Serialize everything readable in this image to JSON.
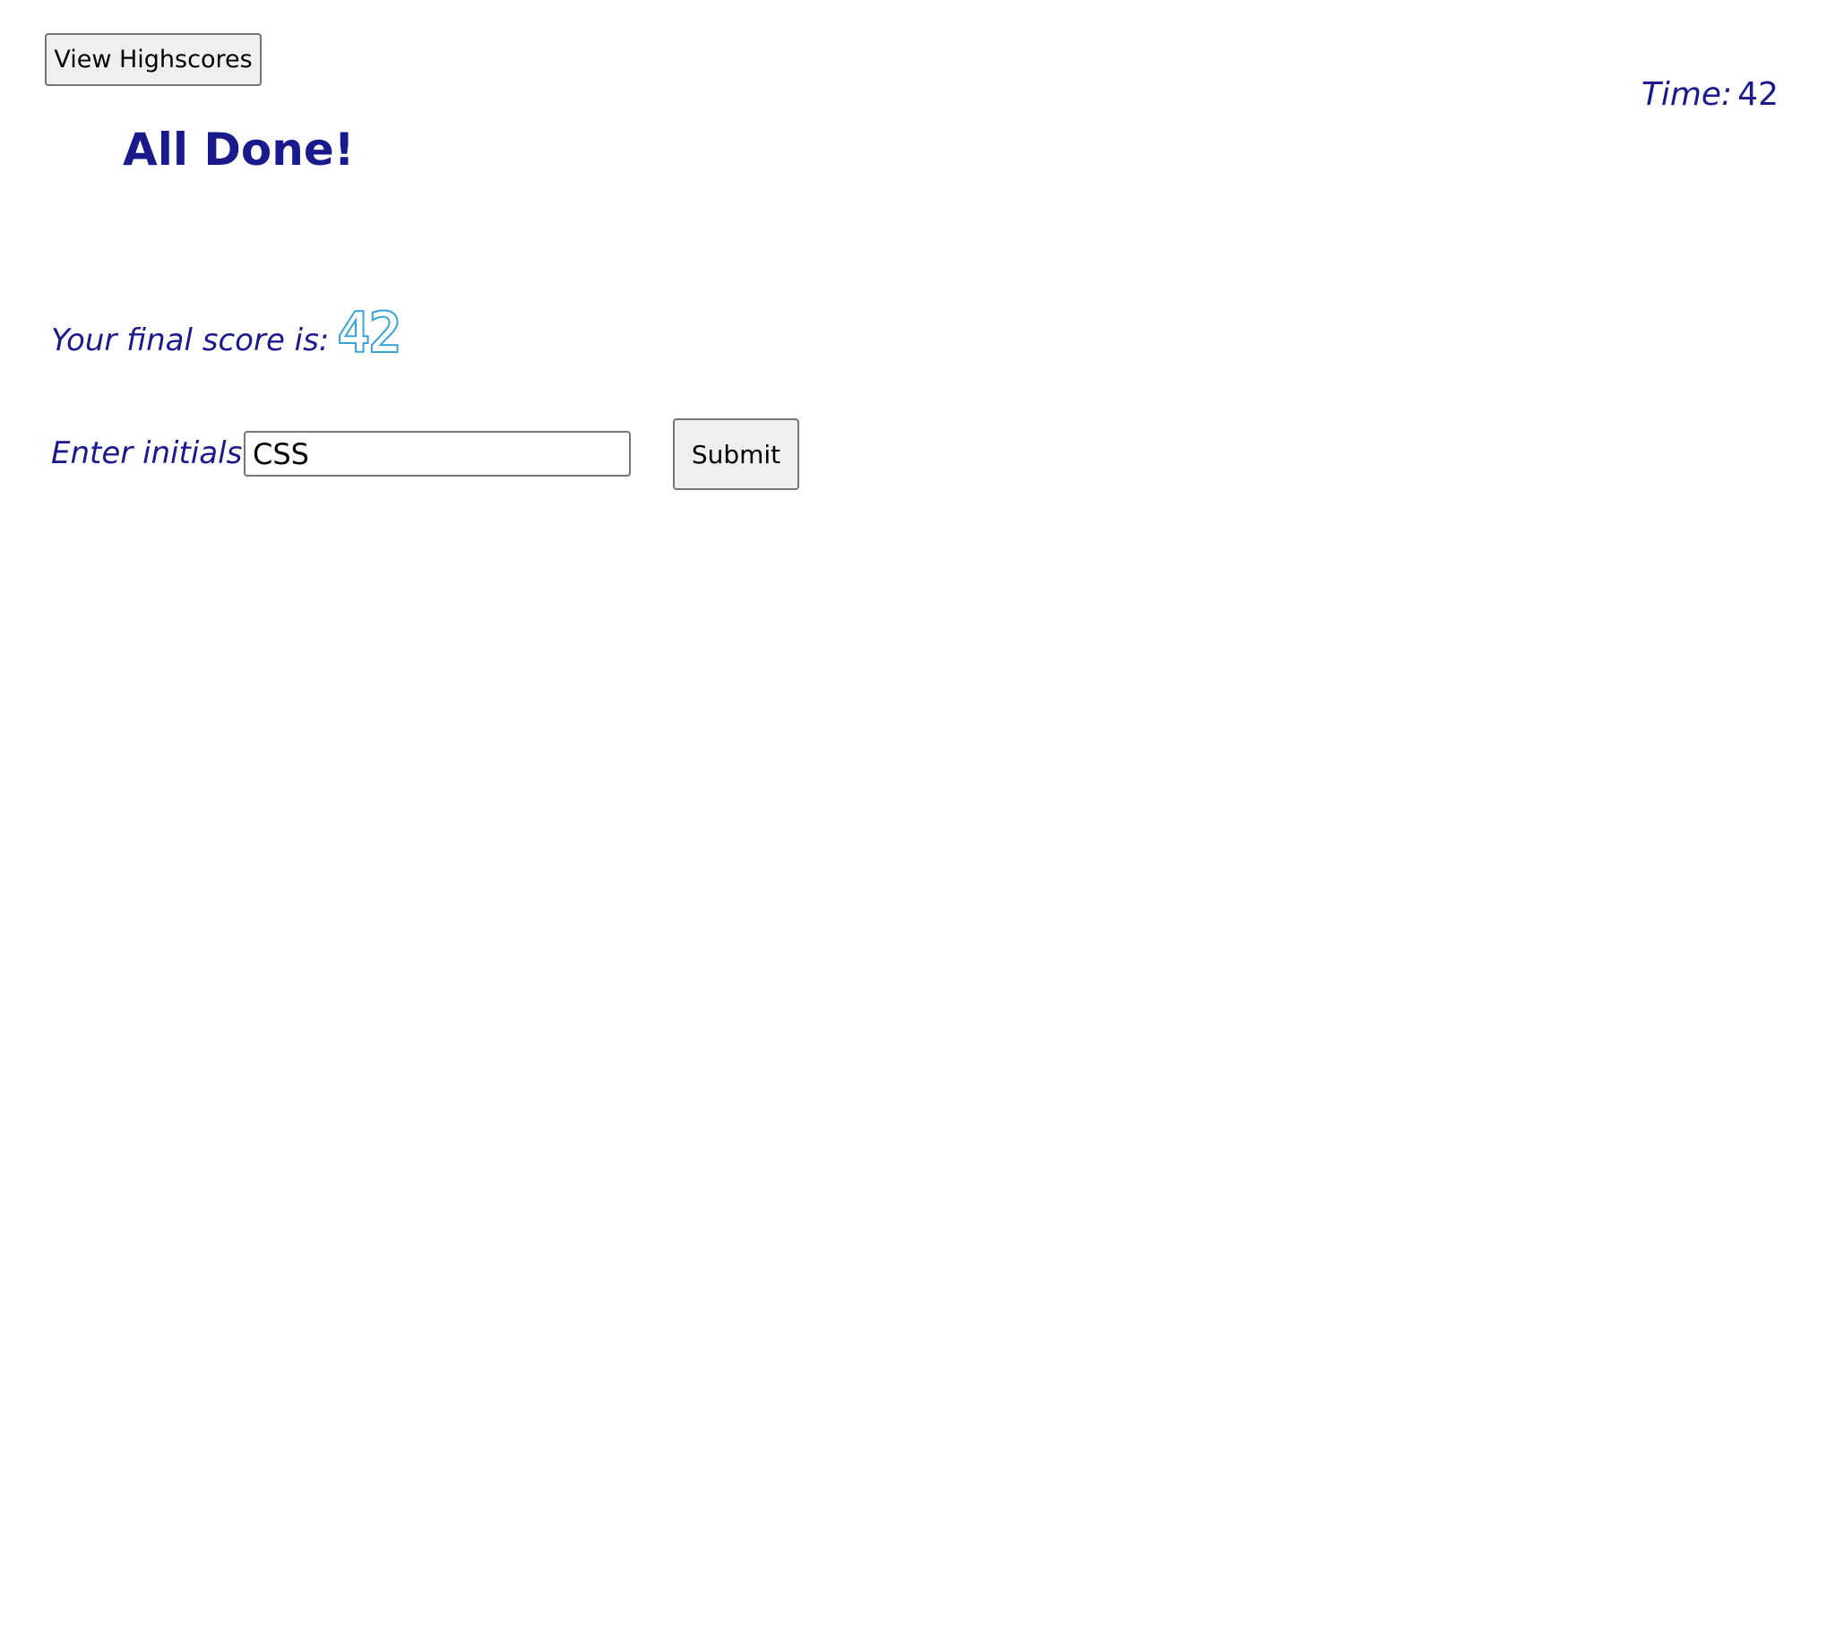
{
  "header": {
    "highscores_label": "View Highscores",
    "timer_label": "Time:",
    "timer_value": "42"
  },
  "main": {
    "title": "All Done!",
    "score_label": "Your final score is:",
    "score_value": "42",
    "initials_label": "Enter initials:",
    "initials_value": "CSS",
    "submit_label": "Submit"
  },
  "colors": {
    "text": "#1a1a8c",
    "score_outline": "#3aa3d6",
    "button_bg": "#efefef",
    "button_border": "#767676"
  }
}
